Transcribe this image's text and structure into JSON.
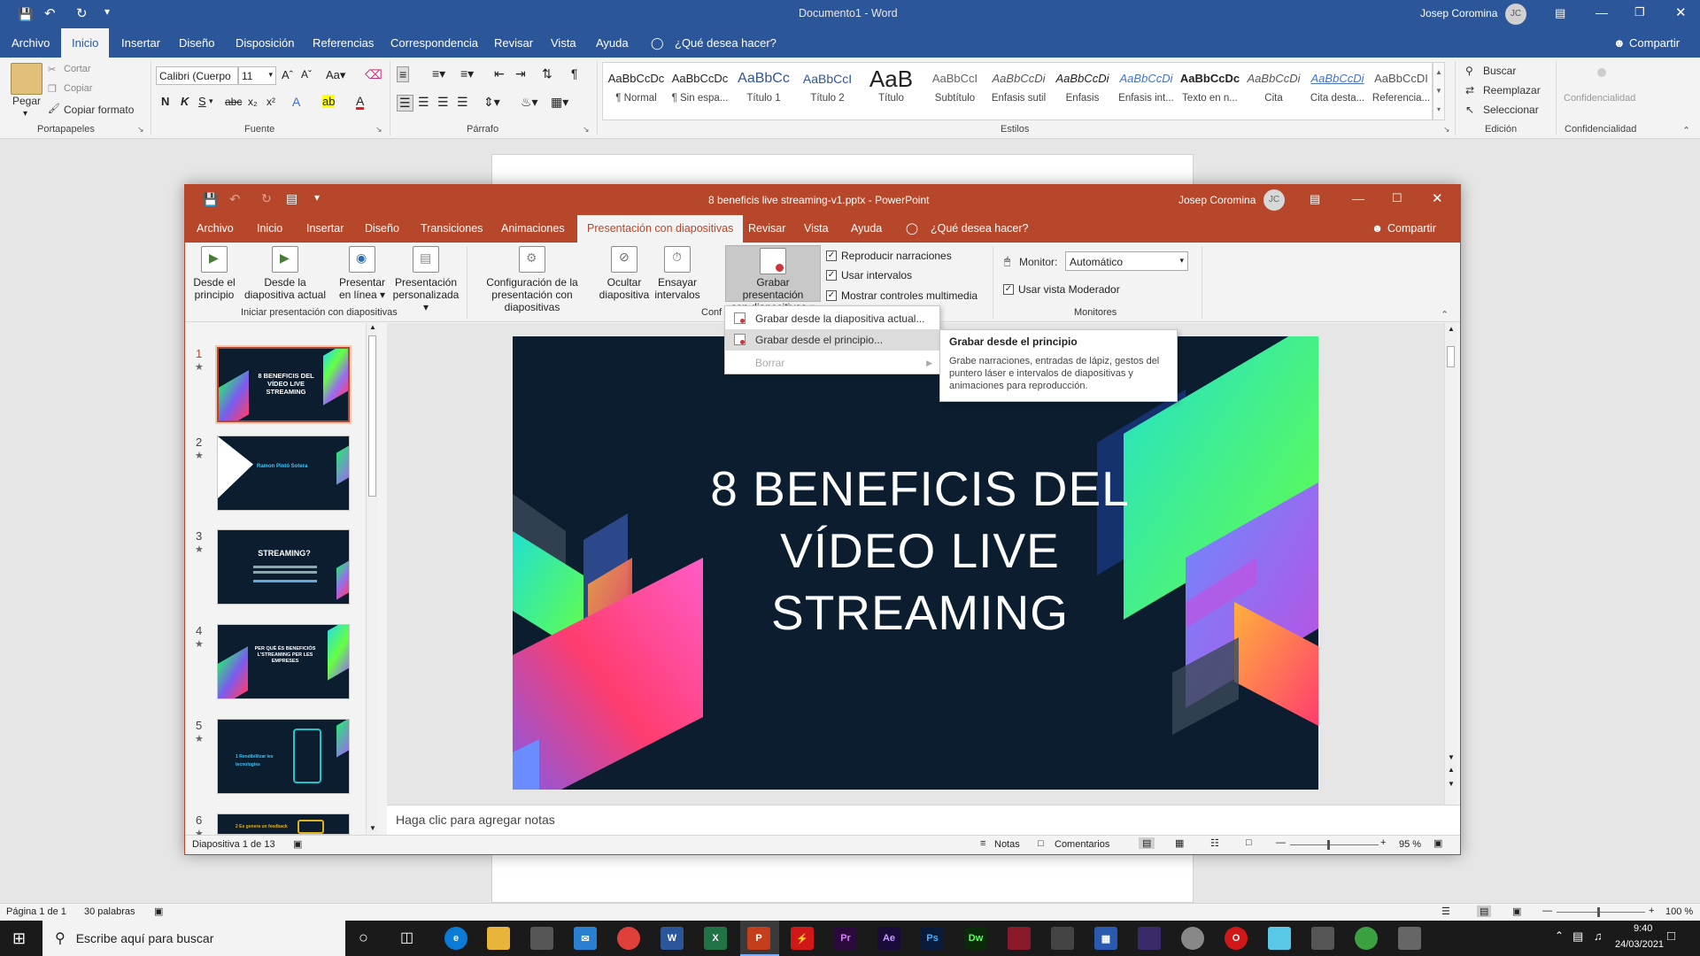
{
  "word": {
    "title": "Documento1 - Word",
    "user": "Josep Coromina",
    "initials": "JC",
    "tabs": [
      "Archivo",
      "Inicio",
      "Insertar",
      "Diseño",
      "Disposición",
      "Referencias",
      "Correspondencia",
      "Revisar",
      "Vista",
      "Ayuda"
    ],
    "tell_me": "¿Qué desea hacer?",
    "share": "Compartir",
    "clipboard": {
      "paste": "Pegar",
      "cut": "Cortar",
      "copy": "Copiar",
      "format": "Copiar formato",
      "label": "Portapapeles"
    },
    "font": {
      "name": "Calibri (Cuerpo",
      "size": "11",
      "label": "Fuente"
    },
    "paragraph_label": "Párrafo",
    "styles": [
      {
        "preview": "AaBbCcDc",
        "name": "¶ Normal"
      },
      {
        "preview": "AaBbCcDc",
        "name": "¶ Sin espa..."
      },
      {
        "preview": "AaBbCc",
        "name": "Título 1"
      },
      {
        "preview": "AaBbCcI",
        "name": "Título 2"
      },
      {
        "preview": "AaB",
        "name": "Título"
      },
      {
        "preview": "AaBbCcI",
        "name": "Subtítulo"
      },
      {
        "preview": "AaBbCcDi",
        "name": "Énfasis sutil"
      },
      {
        "preview": "AaBbCcDi",
        "name": "Énfasis"
      },
      {
        "preview": "AaBbCcDi",
        "name": "Énfasis int..."
      },
      {
        "preview": "AaBbCcDc",
        "name": "Texto en n..."
      },
      {
        "preview": "AaBbCcDi",
        "name": "Cita"
      },
      {
        "preview": "AaBbCcDi",
        "name": "Cita desta..."
      },
      {
        "preview": "AaBbCcDI",
        "name": "Referencia..."
      }
    ],
    "styles_label": "Estilos",
    "editing": {
      "find": "Buscar",
      "replace": "Reemplazar",
      "select": "Seleccionar",
      "label": "Edición"
    },
    "confidentiality": {
      "button": "Confidencialidad",
      "label": "Confidencialidad"
    },
    "status": {
      "page": "Página 1 de 1",
      "words": "30 palabras",
      "zoom": "100 %"
    }
  },
  "powerpoint": {
    "title": "8 beneficis live streaming-v1.pptx - PowerPoint",
    "user": "Josep Coromina",
    "initials": "JC",
    "tabs": [
      "Archivo",
      "Inicio",
      "Insertar",
      "Diseño",
      "Transiciones",
      "Animaciones",
      "Presentación con diapositivas",
      "Revisar",
      "Vista",
      "Ayuda"
    ],
    "tell_me": "¿Qué desea hacer?",
    "share": "Compartir",
    "ribbon": {
      "from_start": [
        "Desde el",
        "principio"
      ],
      "from_current": [
        "Desde la",
        "diapositiva actual"
      ],
      "online": [
        "Presentar",
        "en línea"
      ],
      "custom": [
        "Presentación",
        "personalizada"
      ],
      "start_group": "Iniciar presentación con diapositivas",
      "setup": [
        "Configuración de la",
        "presentación con diapositivas"
      ],
      "hide": [
        "Ocultar",
        "diapositiva"
      ],
      "rehearse": [
        "Ensayar",
        "intervalos"
      ],
      "record": [
        "Grabar presentación",
        "con diapositivas"
      ],
      "config_group": "Conf",
      "checks": [
        "Reproducir narraciones",
        "Usar intervalos",
        "Mostrar controles multimedia"
      ],
      "monitor_label": "Monitor:",
      "monitor_value": "Automático",
      "presenter_view": "Usar vista Moderador",
      "monitors_group": "Monitores"
    },
    "dropdown": [
      "Grabar desde la diapositiva actual...",
      "Grabar desde el principio...",
      "Borrar"
    ],
    "tooltip": {
      "title": "Grabar desde el principio",
      "body": "Grabe narraciones, entradas de lápiz, gestos del puntero láser e intervalos de diapositivas y animaciones para reproducción."
    },
    "slide_title": [
      "8 BENEFICIS DEL",
      "VÍDEO LIVE",
      "STREAMING"
    ],
    "thumbnails": [
      {
        "num": "1",
        "text": "8 BENEFICIS DEL VÍDEO LIVE STREAMING"
      },
      {
        "num": "2",
        "text": "Ramon Pintó Sotera"
      },
      {
        "num": "3",
        "text": "STREAMING?"
      },
      {
        "num": "4",
        "text": "PER QUÈ ÉS BENEFICIÓS L'STREAMING PER LES EMPRESES"
      },
      {
        "num": "5",
        "text": "1 Rendibilitzar les tecnologies"
      },
      {
        "num": "6",
        "text": "2 Es genera un feedback"
      }
    ],
    "notes_placeholder": "Haga clic para agregar notas",
    "status": {
      "slide": "Diapositiva 1 de 13",
      "notes": "Notas",
      "comments": "Comentarios",
      "zoom": "95 %"
    }
  },
  "taskbar": {
    "search_placeholder": "Escribe aquí para buscar",
    "time": "9:40",
    "date": "24/03/2021"
  }
}
